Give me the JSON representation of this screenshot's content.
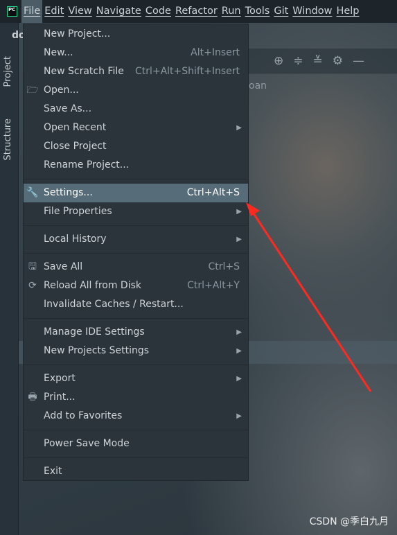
{
  "menubar": {
    "items": [
      "File",
      "Edit",
      "View",
      "Navigate",
      "Code",
      "Refactor",
      "Run",
      "Tools",
      "Git",
      "Window",
      "Help"
    ],
    "active": "File",
    "logo": "PC"
  },
  "project": {
    "title": "do",
    "partial_text": "oan"
  },
  "side_tabs": [
    "Project",
    "Structure"
  ],
  "toolbar": {
    "icons": [
      "locate-icon",
      "expand-all-icon",
      "collapse-all-icon",
      "gear-icon",
      "minimize-icon"
    ]
  },
  "menu": {
    "groups": [
      [
        {
          "label": "New Project...",
          "shortcut": ""
        },
        {
          "label": "New...",
          "shortcut": "Alt+Insert"
        },
        {
          "label": "New Scratch File",
          "shortcut": "Ctrl+Alt+Shift+Insert"
        },
        {
          "label": "Open...",
          "shortcut": "",
          "icon": "folder-icon"
        },
        {
          "label": "Save As...",
          "shortcut": ""
        },
        {
          "label": "Open Recent",
          "shortcut": "",
          "submenu": true
        },
        {
          "label": "Close Project",
          "shortcut": ""
        },
        {
          "label": "Rename Project...",
          "shortcut": ""
        }
      ],
      [
        {
          "label": "Settings...",
          "shortcut": "Ctrl+Alt+S",
          "icon": "wrench-icon",
          "highlighted": true
        },
        {
          "label": "File Properties",
          "shortcut": "",
          "submenu": true
        }
      ],
      [
        {
          "label": "Local History",
          "shortcut": "",
          "submenu": true
        }
      ],
      [
        {
          "label": "Save All",
          "shortcut": "Ctrl+S",
          "icon": "save-icon"
        },
        {
          "label": "Reload All from Disk",
          "shortcut": "Ctrl+Alt+Y",
          "icon": "reload-icon"
        },
        {
          "label": "Invalidate Caches / Restart...",
          "shortcut": ""
        }
      ],
      [
        {
          "label": "Manage IDE Settings",
          "shortcut": "",
          "submenu": true
        },
        {
          "label": "New Projects Settings",
          "shortcut": "",
          "submenu": true
        }
      ],
      [
        {
          "label": "Export",
          "shortcut": "",
          "submenu": true
        },
        {
          "label": "Print...",
          "shortcut": "",
          "icon": "printer-icon"
        },
        {
          "label": "Add to Favorites",
          "shortcut": "",
          "submenu": true
        }
      ],
      [
        {
          "label": "Power Save Mode",
          "shortcut": ""
        }
      ],
      [
        {
          "label": "Exit",
          "shortcut": ""
        }
      ]
    ]
  },
  "annotation": {
    "color": "#ff2a1f"
  },
  "watermark": "CSDN @季白九月"
}
